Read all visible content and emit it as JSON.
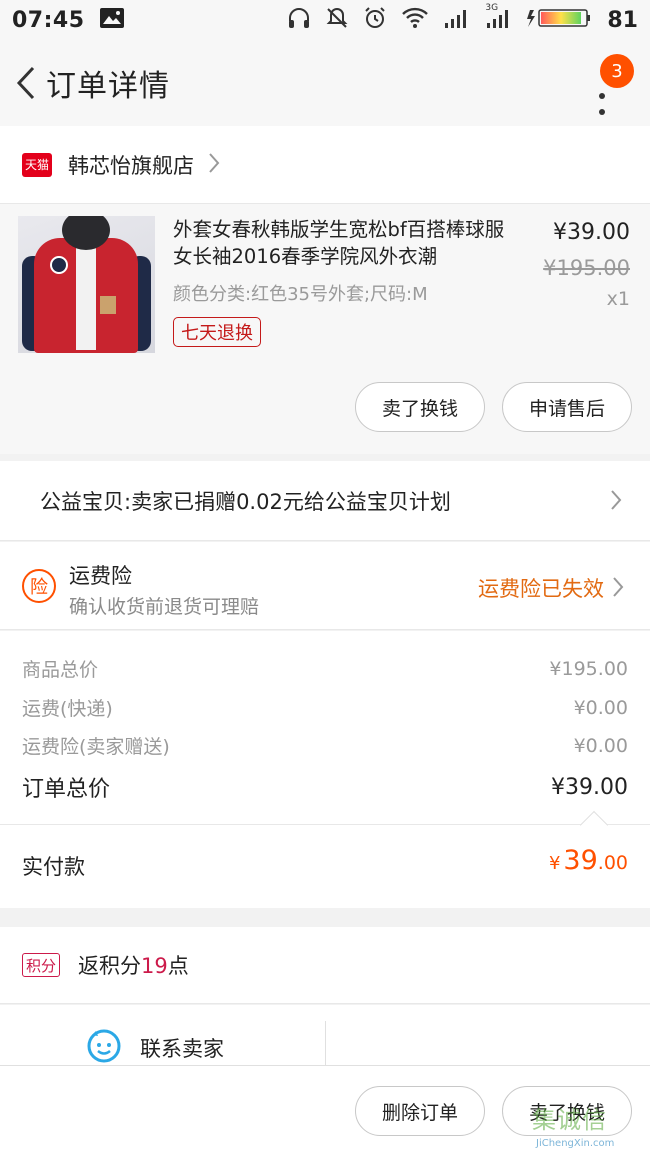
{
  "status_bar": {
    "time": "07:45",
    "battery": "81",
    "network_tag": "3G"
  },
  "nav": {
    "title": "订单详情",
    "badge_count": "3"
  },
  "store": {
    "logo_text": "天猫",
    "name": "韩芯怡旗舰店"
  },
  "product": {
    "title": "外套女春秋韩版学生宽松bf百搭棒球服女长袖2016春季学院风外衣潮",
    "spec": "颜色分类:红色35号外套;尺码:M",
    "return_policy": "七天退换",
    "price": "¥39.00",
    "original_price": "¥195.00",
    "quantity": "x1",
    "actions": [
      "卖了换钱",
      "申请售后"
    ]
  },
  "charity": {
    "text": "公益宝贝:卖家已捐赠0.02元给公益宝贝计划"
  },
  "insurance": {
    "icon_text": "险",
    "title": "运费险",
    "subtitle": "确认收货前退货可理赔",
    "status": "运费险已失效"
  },
  "summary": {
    "rows": [
      {
        "label": "商品总价",
        "value": "¥195.00"
      },
      {
        "label": "运费(快递)",
        "value": "¥0.00"
      },
      {
        "label": "运费险(卖家赠送)",
        "value": "¥0.00"
      }
    ],
    "total_label": "订单总价",
    "total_value": "¥39.00"
  },
  "paid": {
    "label": "实付款",
    "currency": "¥",
    "integer": "39",
    "decimal": ".00"
  },
  "points": {
    "tag": "积分",
    "prefix": "返积分",
    "value": "19",
    "suffix": "点"
  },
  "contact": {
    "label": "联系卖家"
  },
  "bottom": {
    "delete_label": "删除订单",
    "sell_label": "卖了换钱"
  },
  "watermark": {
    "main": "集诚信",
    "sub": "JiChengXin.com"
  },
  "colors": {
    "accent": "#ff5000",
    "tmall_red": "#e3001b",
    "points_red": "#cc1a4a",
    "insurance_orange": "#e26a12"
  }
}
